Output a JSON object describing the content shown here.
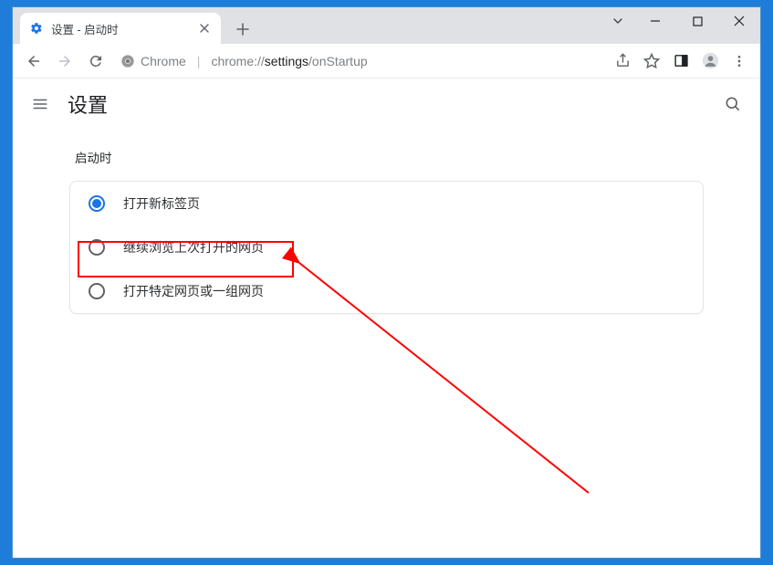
{
  "window": {
    "tab_title": "设置 - 启动时"
  },
  "toolbar": {
    "url_prefix": "Chrome",
    "url_dim": "chrome://",
    "url_dark": "settings",
    "url_trail": "/onStartup"
  },
  "page": {
    "title": "设置",
    "section_label": "启动时",
    "options": [
      {
        "label": "打开新标签页",
        "selected": true
      },
      {
        "label": "继续浏览上次打开的网页",
        "selected": false
      },
      {
        "label": "打开特定网页或一组网页",
        "selected": false
      }
    ]
  },
  "annotation": {
    "highlighted_option_index": 1
  }
}
